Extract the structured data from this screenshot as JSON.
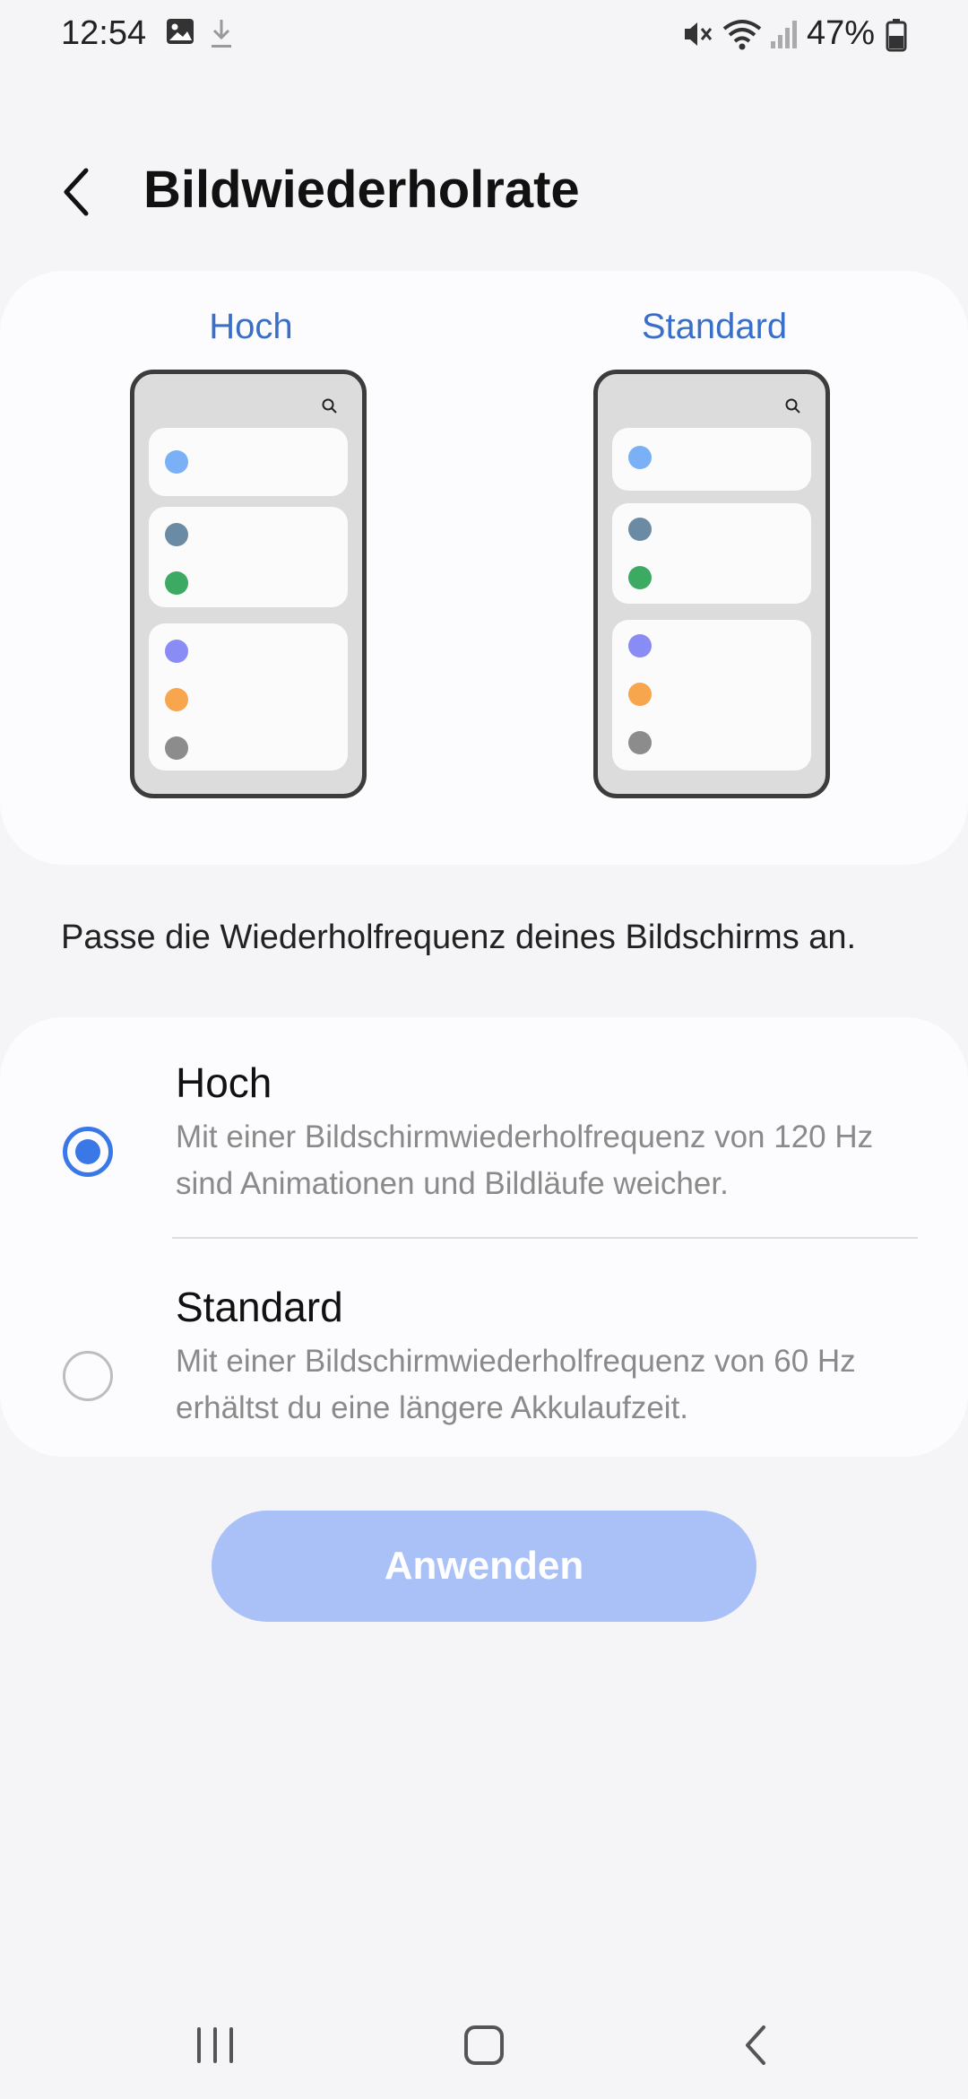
{
  "status_bar": {
    "time": "12:54",
    "battery_percent": "47%",
    "icons": [
      "gallery-icon",
      "download-icon",
      "mute-icon",
      "wifi-icon",
      "signal-icon",
      "battery-icon"
    ]
  },
  "header": {
    "title": "Bildwiederholrate",
    "back_icon": "chevron-left-icon"
  },
  "preview": {
    "high_label": "Hoch",
    "standard_label": "Standard",
    "dot_colors": [
      "#7ab0f5",
      "#6b8aa3",
      "#3daa63",
      "#8a8cf5",
      "#f7a64e",
      "#8c8c8c"
    ]
  },
  "description": "Passe die Wiederholfrequenz deines Bildschirms an.",
  "options": [
    {
      "title": "Hoch",
      "subtitle": "Mit einer Bildschirmwiederholfrequenz von 120 Hz sind Animationen und Bildläufe weicher.",
      "selected": true
    },
    {
      "title": "Standard",
      "subtitle": "Mit einer Bildschirmwiederholfrequenz von 60 Hz erhältst du eine längere Akkulaufzeit.",
      "selected": false
    }
  ],
  "apply_button": {
    "label": "Anwenden",
    "enabled": false
  },
  "colors": {
    "accent": "#3b78e7",
    "label_blue": "#3a6fc8",
    "button_disabled": "#a9c1f7"
  },
  "navbar": {
    "icons": [
      "recent-apps-icon",
      "home-icon",
      "back-icon"
    ]
  }
}
